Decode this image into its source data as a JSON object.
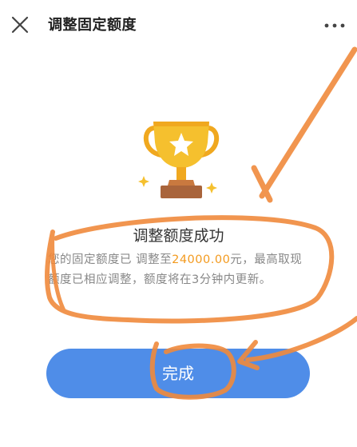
{
  "header": {
    "title": "调整固定额度",
    "close_icon": "close-icon",
    "more_icon": "more-icon"
  },
  "result": {
    "icon": "trophy-icon",
    "title": "调整额度成功",
    "desc_before": "您的固定额度已 调整至",
    "amount": "24000.00",
    "desc_after": "元，最高取现额度已相应调整，额度将在3分钟内更新。"
  },
  "done_button": {
    "label": "完成"
  },
  "colors": {
    "accent_blue": "#4f8de8",
    "amount_orange": "#f39a1e",
    "annotation_orange": "#f08a3c",
    "trophy_gold": "#f5c02e",
    "trophy_base": "#a9643b"
  }
}
